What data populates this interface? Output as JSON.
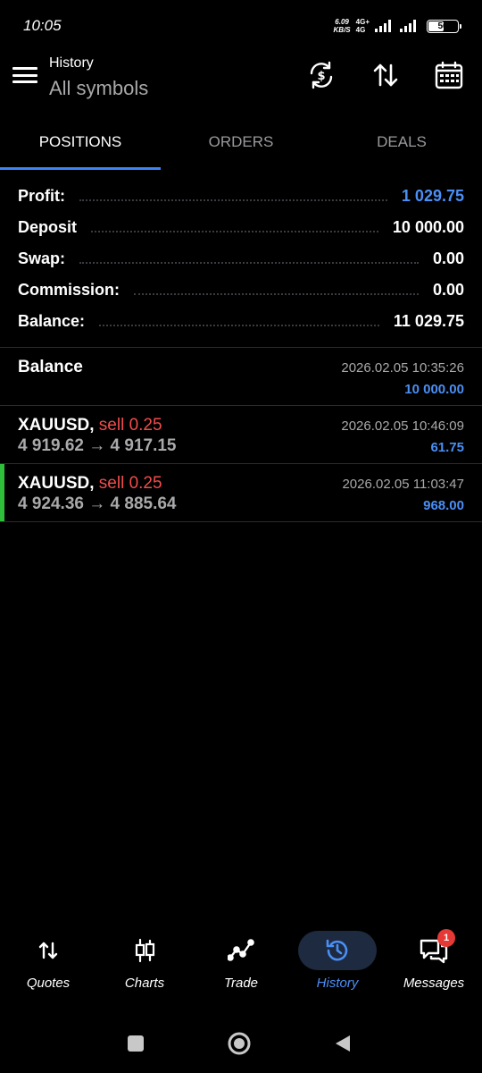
{
  "status": {
    "time": "10:05",
    "net_speed_value": "6.09",
    "net_speed_unit": "KB/S",
    "net_type": "4G+",
    "net_sub": "4G",
    "battery": "56",
    "battery_level": 0.56
  },
  "header": {
    "title": "History",
    "subtitle": "All symbols"
  },
  "tabs": [
    {
      "label": "POSITIONS",
      "active": true
    },
    {
      "label": "ORDERS",
      "active": false
    },
    {
      "label": "DEALS",
      "active": false
    }
  ],
  "summary": [
    {
      "label": "Profit:",
      "value": "1 029.75"
    },
    {
      "label": "Deposit",
      "value": "10 000.00"
    },
    {
      "label": "Swap:",
      "value": "0.00"
    },
    {
      "label": "Commission:",
      "value": "0.00"
    },
    {
      "label": "Balance:",
      "value": "11 029.75"
    }
  ],
  "entries": [
    {
      "title": "Balance",
      "time": "2026.02.05 10:35:26",
      "amount": "10 000.00"
    },
    {
      "symbol": "XAUUSD,",
      "type": "sell 0.25",
      "open": "4 919.62",
      "arrow": "→",
      "close": "4 917.15",
      "time": "2026.02.05 10:46:09",
      "amount": "61.75"
    },
    {
      "symbol": "XAUUSD,",
      "type": "sell 0.25",
      "open": "4 924.36",
      "arrow": "→",
      "close": "4 885.64",
      "time": "2026.02.05 11:03:47",
      "amount": "968.00"
    }
  ],
  "nav": [
    {
      "label": "Quotes",
      "icon": "quotes-arrows-icon"
    },
    {
      "label": "Charts",
      "icon": "candlestick-icon"
    },
    {
      "label": "Trade",
      "icon": "trend-line-icon"
    },
    {
      "label": "History",
      "icon": "history-clock-icon",
      "active": true
    },
    {
      "label": "Messages",
      "icon": "chat-bubbles-icon",
      "badge": "1"
    }
  ],
  "colors": {
    "accent": "#3d84f7",
    "value_blue": "#4b8ff5",
    "sell_red": "#f24c4c",
    "highlight_green": "#2fbf3a"
  }
}
